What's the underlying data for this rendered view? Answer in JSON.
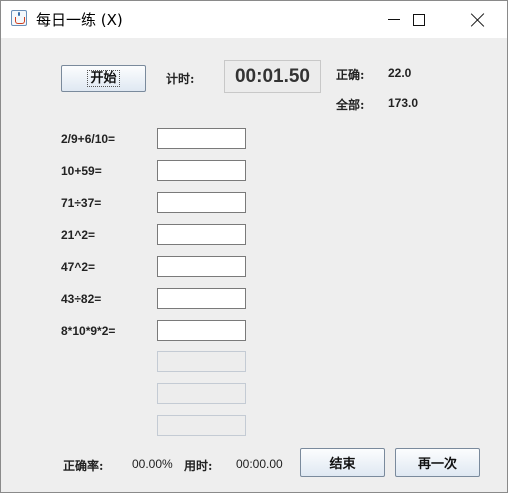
{
  "window": {
    "title": "每日一练 (X)",
    "icon": "java-cup-icon",
    "controls": [
      "minimize-icon",
      "maximize-icon",
      "close-icon"
    ]
  },
  "toolbar": {
    "start_label": "开始",
    "timer_label": "计时:",
    "timer_value": "00:01.50",
    "correct_label": "正确:",
    "correct_value": "22.0",
    "total_label": "全部:",
    "total_value": "173.0"
  },
  "questions": [
    {
      "text": "2/9+6/10=",
      "answer": ""
    },
    {
      "text": "10+59=",
      "answer": ""
    },
    {
      "text": "71÷37=",
      "answer": ""
    },
    {
      "text": "21^2=",
      "answer": ""
    },
    {
      "text": "47^2=",
      "answer": ""
    },
    {
      "text": "43÷82=",
      "answer": ""
    },
    {
      "text": "8*10*9*2=",
      "answer": ""
    }
  ],
  "footer": {
    "accuracy_label": "正确率:",
    "accuracy_value": "00.00%",
    "time_label": "用时:",
    "time_value": "00:00.00",
    "end_label": "结束",
    "again_label": "再一次"
  },
  "colors": {
    "window_bg": "#eeeeee",
    "titlebar_bg": "#ffffff",
    "button_gradient_top": "#fcfdfe",
    "button_gradient_bottom": "#dfe8f2"
  }
}
